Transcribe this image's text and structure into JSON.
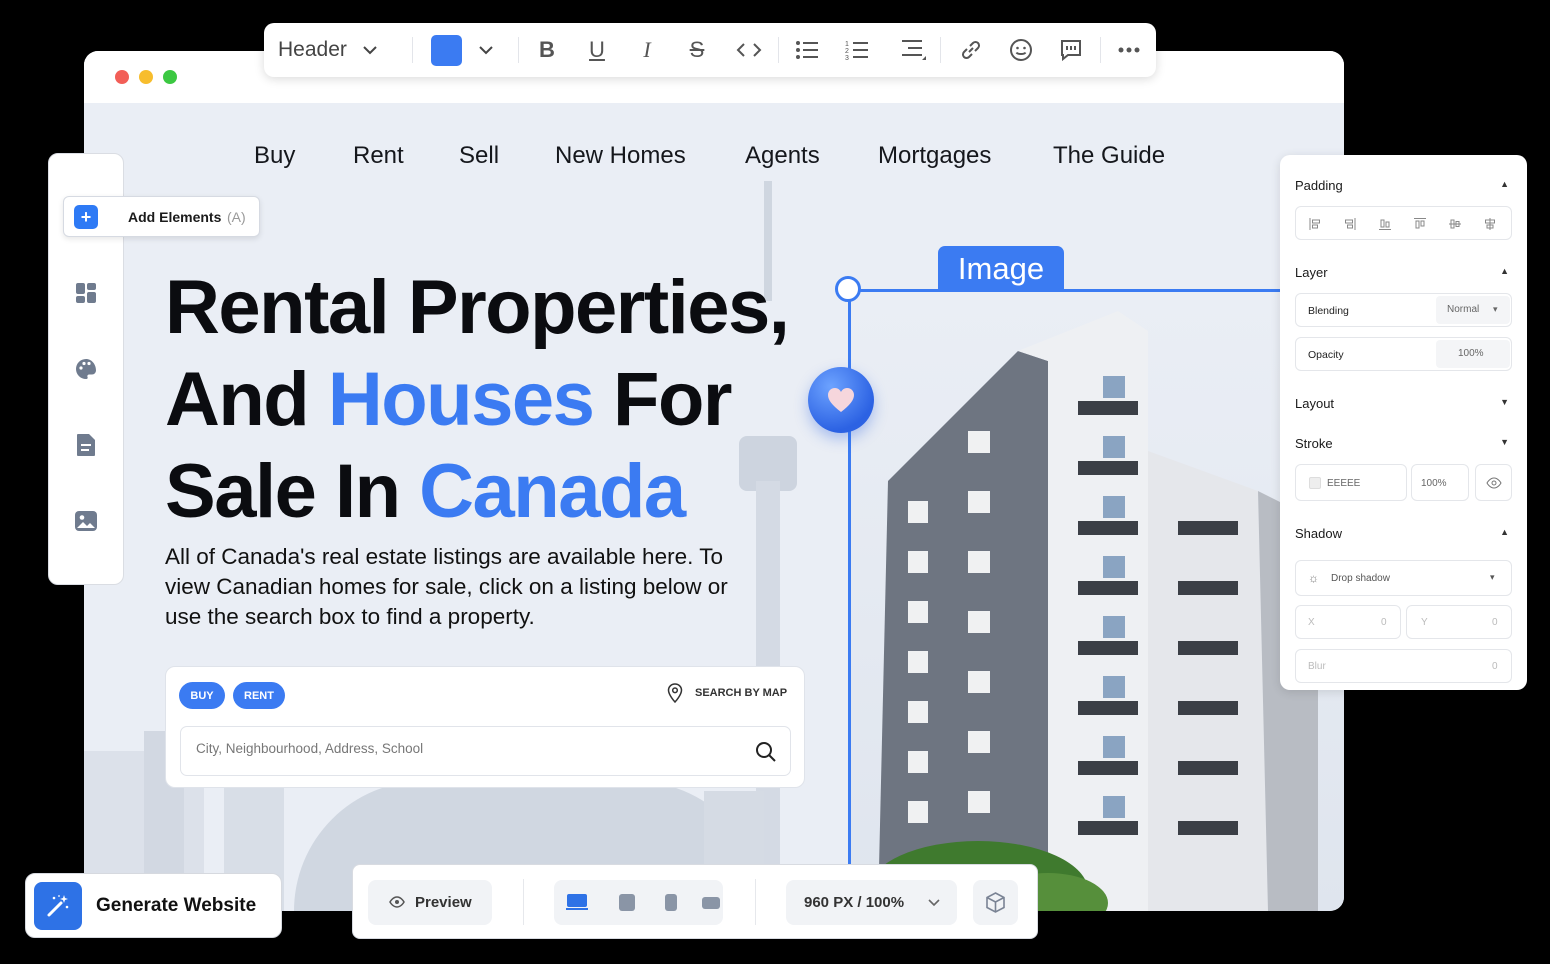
{
  "toolbar": {
    "block_type": "Header",
    "color": "#3b7bf2",
    "icons": [
      "chevron-down-icon",
      "color-swatch",
      "chevron-down-icon",
      "bold-icon",
      "underline-icon",
      "italic-icon",
      "strikethrough-icon",
      "code-icon",
      "bullet-list-icon",
      "numbered-list-icon",
      "align-icon",
      "link-icon",
      "emoji-icon",
      "comment-icon",
      "more-icon"
    ]
  },
  "nav": {
    "items": [
      "Buy",
      "Rent",
      "Sell",
      "New Homes",
      "Agents",
      "Mortgages",
      "The Guide"
    ]
  },
  "hero": {
    "line1": "Rental Properties,",
    "line2_a": "And ",
    "line2_accent": "Houses",
    "line2_b": " For",
    "line3_a": "Sale In ",
    "line3_accent": "Canada",
    "subtitle": "All of Canada's real estate listings are available here. To view Canadian homes for sale, click on a listing below or use the search box to find a property."
  },
  "search": {
    "buy_label": "BUY",
    "rent_label": "RENT",
    "map_label": "SEARCH BY MAP",
    "placeholder": "City, Neighbourhood, Address, School"
  },
  "selection": {
    "label": "Image"
  },
  "sidebar": {
    "add_label": "Add Elements",
    "add_shortcut": "(A)",
    "icons": [
      "dashboard-icon",
      "palette-icon",
      "document-icon",
      "image-icon"
    ]
  },
  "panel": {
    "padding_title": "Padding",
    "layer_title": "Layer",
    "blending_label": "Blending",
    "blending_value": "Normal",
    "opacity_label": "Opacity",
    "opacity_value": "100%",
    "layout_title": "Layout",
    "stroke_title": "Stroke",
    "stroke_color": "EEEEE",
    "stroke_opacity": "100%",
    "shadow_title": "Shadow",
    "shadow_type": "Drop shadow",
    "x_label": "X",
    "x_value": "0",
    "y_label": "Y",
    "y_value": "0",
    "blur_label": "Blur",
    "blur_value": "0"
  },
  "bottom": {
    "preview_label": "Preview",
    "zoom_label": "960 PX / 100%"
  },
  "generate": {
    "label": "Generate Website"
  },
  "colors": {
    "accent": "#3b7bf2",
    "window_bg": "#eaeef5"
  }
}
